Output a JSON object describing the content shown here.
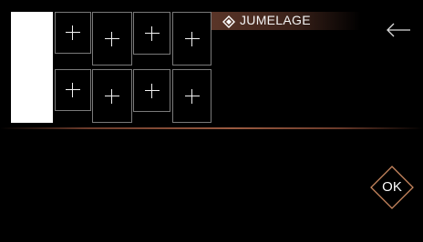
{
  "header": {
    "title": "JUMELAGE",
    "title_icon": "diamond-pairing-icon",
    "back_icon": "left-arrow-icon"
  },
  "slots": {
    "row1": [
      {
        "symbol": "+"
      },
      {
        "symbol": "+"
      },
      {
        "symbol": "+"
      },
      {
        "symbol": "+"
      }
    ],
    "row2": [
      {
        "symbol": "+"
      },
      {
        "symbol": "+"
      },
      {
        "symbol": "+"
      },
      {
        "symbol": "+"
      }
    ]
  },
  "actions": {
    "ok_label": "OK"
  },
  "colors": {
    "accent": "#9a5a40",
    "slot_border": "#7a7a7a",
    "background": "#000000"
  }
}
